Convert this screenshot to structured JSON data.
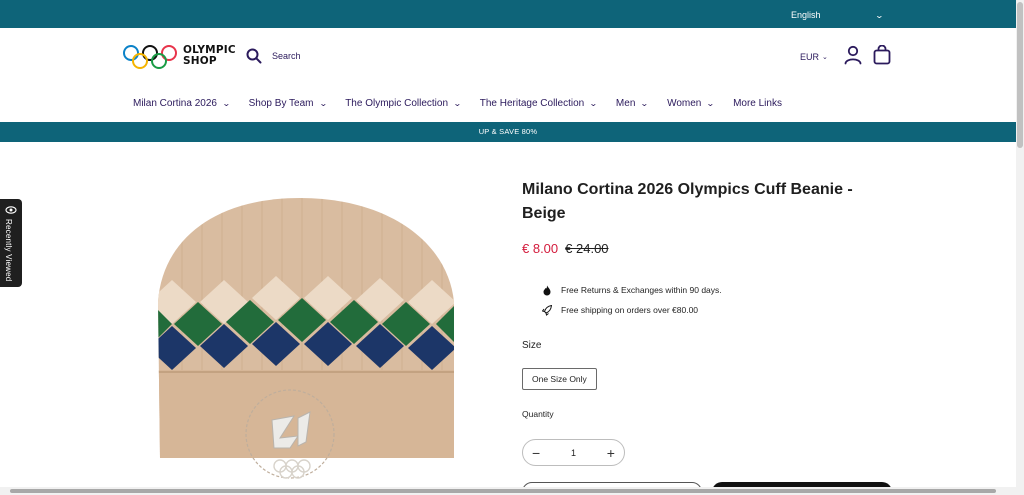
{
  "topbar": {
    "language": "English"
  },
  "header": {
    "logo_line1": "OLYMPIC",
    "logo_line2": "SHOP",
    "search_label": "Search",
    "currency": "EUR"
  },
  "nav": {
    "items": [
      {
        "label": "Milan Cortina 2026",
        "dropdown": true
      },
      {
        "label": "Shop By Team",
        "dropdown": true
      },
      {
        "label": "The Olympic Collection",
        "dropdown": true
      },
      {
        "label": "The Heritage Collection",
        "dropdown": true
      },
      {
        "label": "Men",
        "dropdown": true
      },
      {
        "label": "Women",
        "dropdown": true
      },
      {
        "label": "More Links",
        "dropdown": false
      }
    ]
  },
  "promo": {
    "text": "UP & SAVE 80%"
  },
  "recently_viewed": {
    "label": "Recently Viewed"
  },
  "product": {
    "title": "Milano Cortina 2026 Olympics Cuff Beanie - Beige",
    "price_sale": "€ 8.00",
    "price_original": "€ 24.00",
    "perks": [
      {
        "icon": "flame-icon",
        "text": "Free Returns & Exchanges within 90 days."
      },
      {
        "icon": "rocket-icon",
        "text": "Free shipping on orders over €80.00"
      }
    ],
    "size_label": "Size",
    "size_option": "One Size Only",
    "quantity_label": "Quantity",
    "quantity_value": "1"
  },
  "colors": {
    "brand_teal": "#0e6479",
    "nav_text": "#2b1a5c",
    "sale_red": "#d31b3c",
    "beanie_beige": "#d9bca0",
    "beanie_green": "#226c3b",
    "beanie_navy": "#1c3668"
  }
}
